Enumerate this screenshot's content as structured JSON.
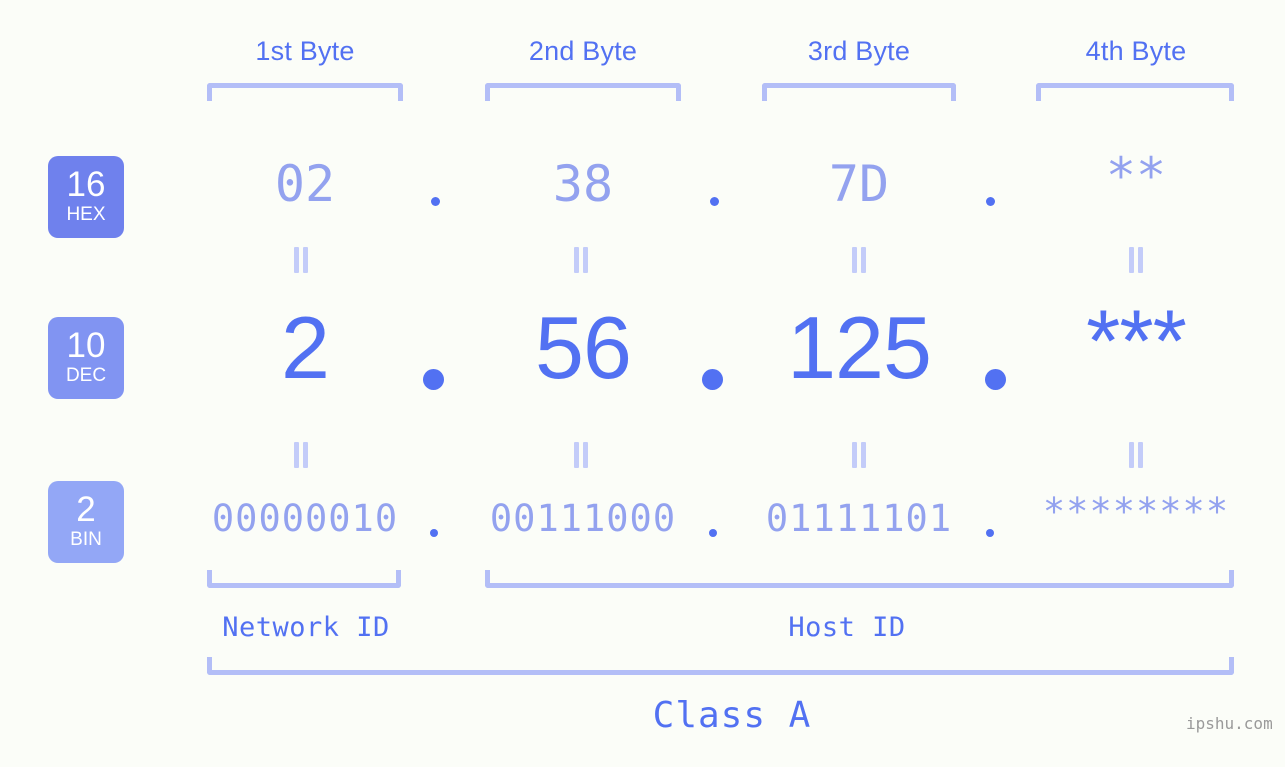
{
  "meta": {
    "background_color": "#fbfdf8",
    "accent_color": "#5271f2",
    "accent_light_color": "#93a2ef",
    "bracket_color": "#b3bef7"
  },
  "header": {
    "byte_labels": [
      {
        "text": "1st Byte"
      },
      {
        "text": "2nd Byte"
      },
      {
        "text": "3rd Byte"
      },
      {
        "text": "4th Byte"
      }
    ]
  },
  "bases": [
    {
      "number": "16",
      "name": "HEX",
      "color": "#6f81ed"
    },
    {
      "number": "10",
      "name": "DEC",
      "color": "#8194f2"
    },
    {
      "number": "2",
      "name": "BIN",
      "color": "#93a7f6"
    }
  ],
  "rows": {
    "hex": {
      "base_number": "16",
      "base_name": "HEX",
      "values": [
        "02",
        "38",
        "7D",
        "**"
      ],
      "separator": "."
    },
    "dec": {
      "base_number": "10",
      "base_name": "DEC",
      "values": [
        "2",
        "56",
        "125",
        "***"
      ],
      "separator": "."
    },
    "bin": {
      "base_number": "2",
      "base_name": "BIN",
      "values": [
        "00000010",
        "00111000",
        "01111101",
        "********"
      ],
      "separator": "."
    }
  },
  "equality_marker": "||",
  "footer": {
    "network_id_label": "Network ID",
    "host_id_label": "Host ID",
    "class_label": "Class A"
  },
  "watermark": {
    "text": "ipshu.com"
  }
}
